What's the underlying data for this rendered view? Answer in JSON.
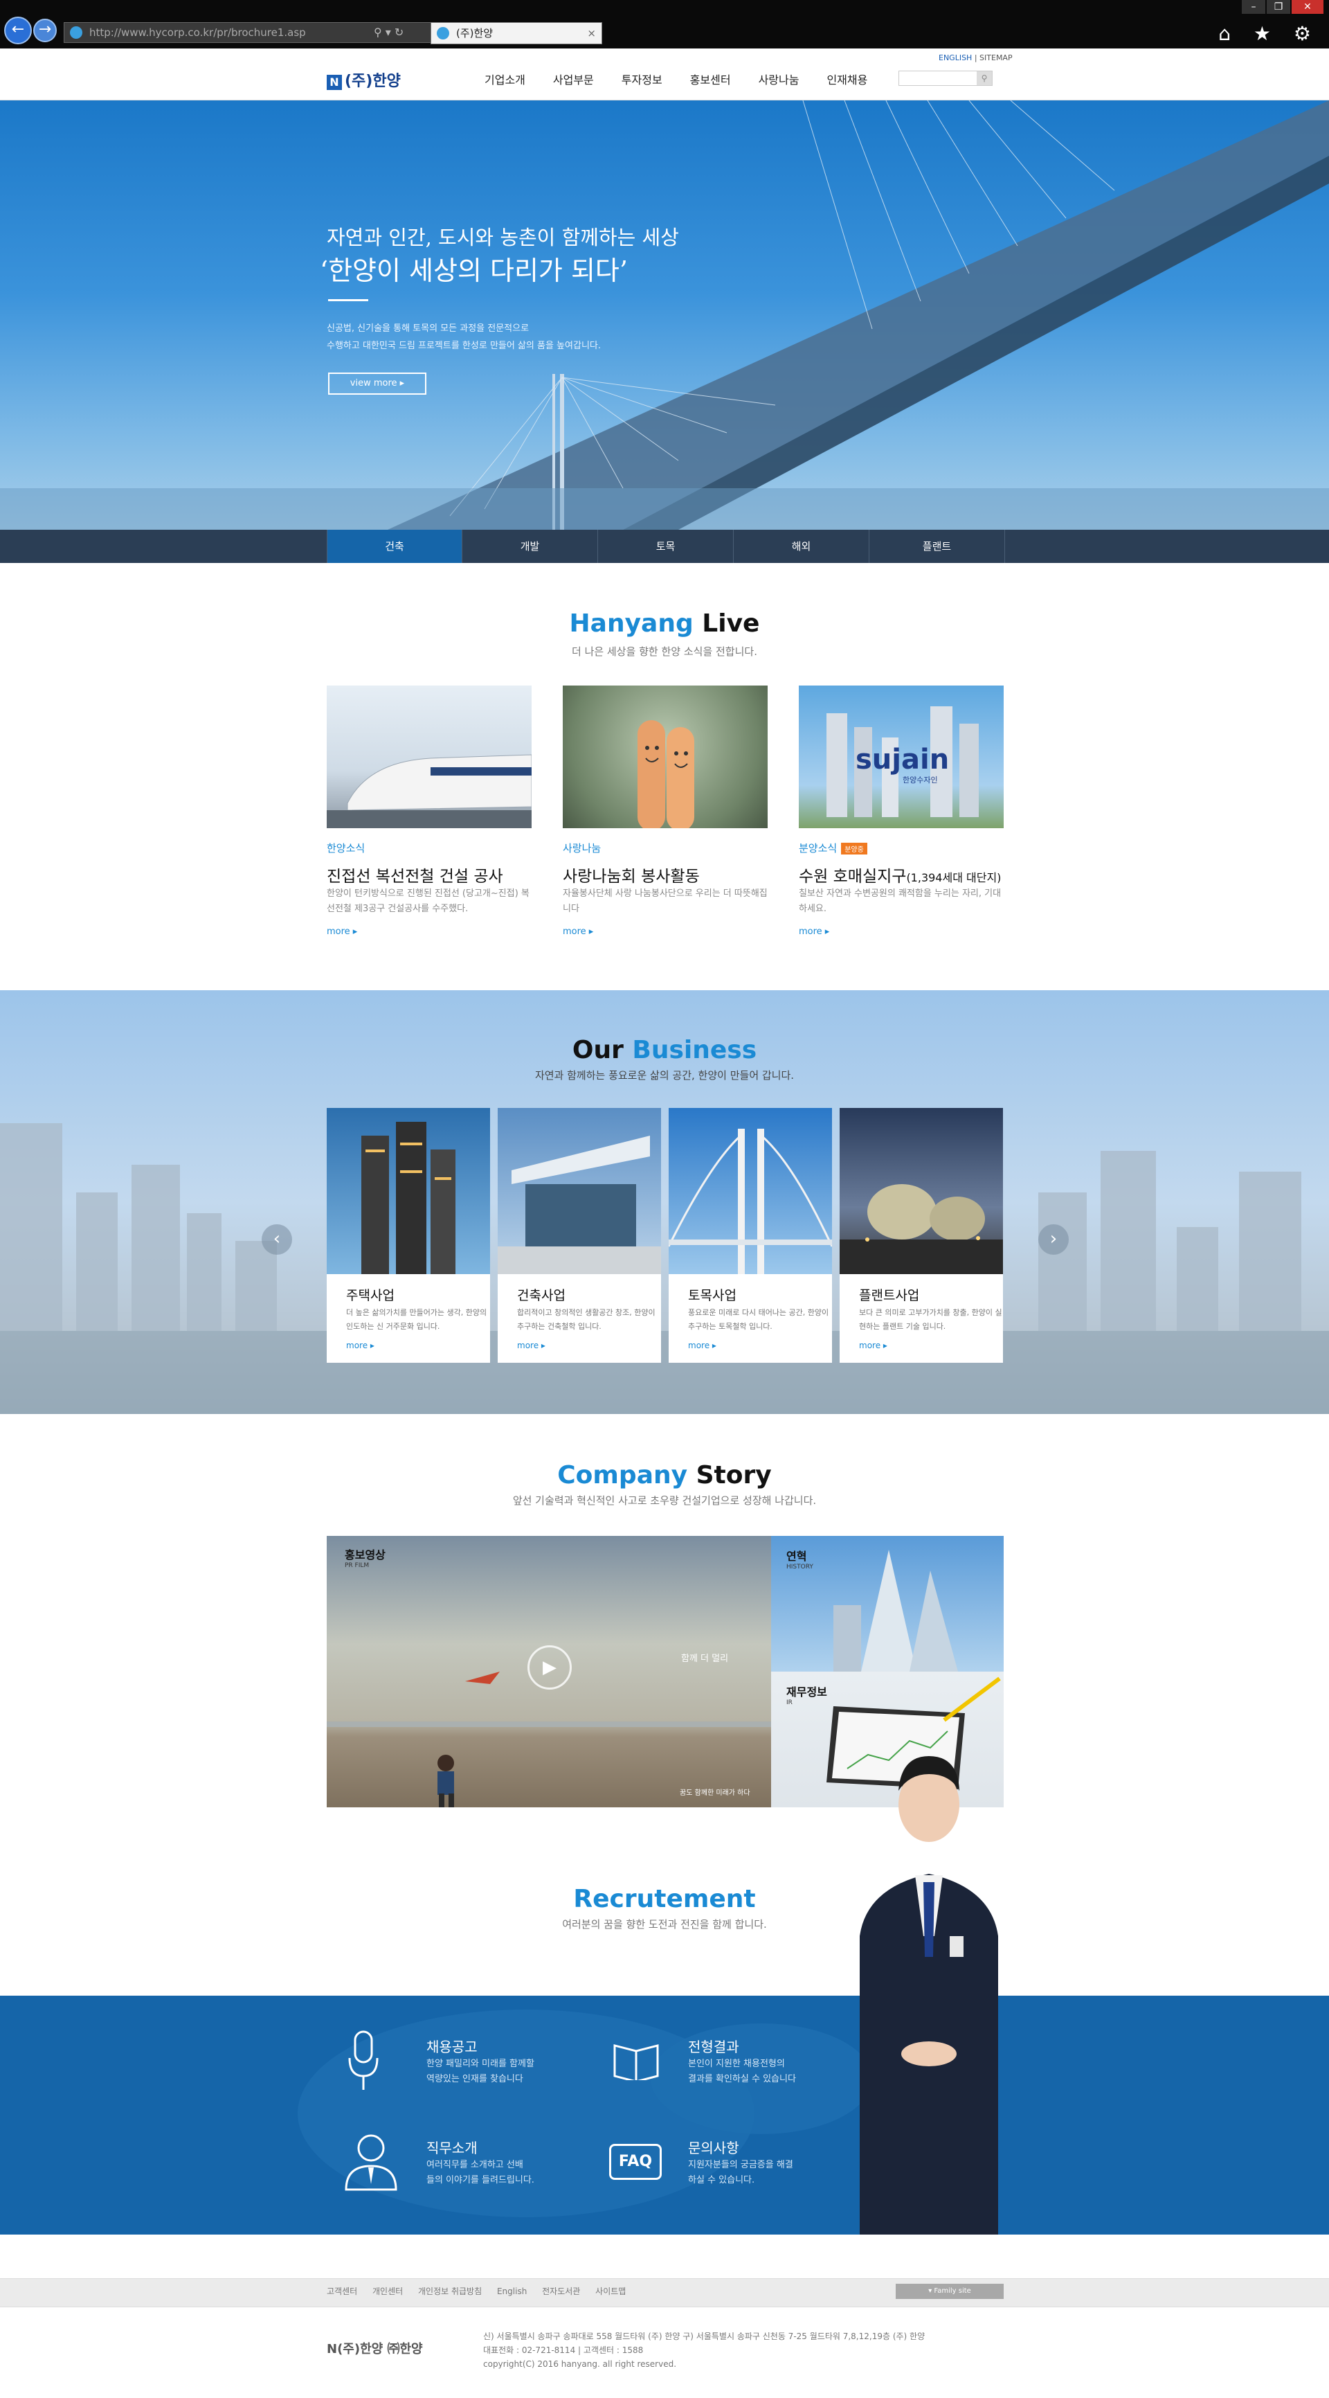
{
  "browser": {
    "url": "http://www.hycorp.co.kr/pr/brochure1.asp",
    "tab_title": "(주)한양",
    "back_glyph": "←",
    "forward_glyph": "→",
    "tab_close_glyph": "×",
    "window_controls": [
      "–",
      "❐",
      "✕"
    ],
    "tools_glyphs": "⌂ ★ ⚙",
    "address_tools": "⚲ ▾ ↻"
  },
  "header": {
    "logo_mark": "N",
    "logo_text": "(주)한양",
    "util_links": {
      "english": "ENGLISH",
      "sep": " | ",
      "sitemap": "SITEMAP"
    },
    "nav": [
      "기업소개",
      "사업부문",
      "투자정보",
      "홍보센터",
      "사랑나눔",
      "인재채용"
    ],
    "search_button_glyph": "⚲"
  },
  "hero": {
    "line1": "자연과 인간, 도시와 농촌이 함께하는 세상",
    "line2": "‘한양이 세상의 다리가 되다’",
    "desc1": "신공법, 신기술을 통해 토목의 모든 과정을 전문적으로",
    "desc2": "수행하고 대한민국 드림 프로젝트를 한성로 만들어 삶의 품을 높여갑니다.",
    "button": "view more ▸",
    "tabs": [
      "건축",
      "개발",
      "토목",
      "해외",
      "플랜트"
    ],
    "active_tab": 0
  },
  "live": {
    "title_a": "Hanyang",
    "title_b": " Live",
    "subtitle": "더 나은 세상을 향한 한양 소식을 전합니다.",
    "items": [
      {
        "category": "한양소식",
        "badge": "",
        "title": "진접선 복선전철 건설 공사",
        "desc": "한양이 턴키방식으로 진행된 진접선 (당고개~진접) 복선전철 제3공구 건설공사를 수주했다.",
        "more": "more ▸"
      },
      {
        "category": "사랑나눔",
        "badge": "",
        "title": "사랑나눔회 봉사활동",
        "desc": "자율봉사단체 사랑 나눔봉사단으로 우리는 더 따뜻해집니다",
        "more": "more ▸"
      },
      {
        "category": "분양소식",
        "badge": "분양중",
        "title": "수원 호매실지구",
        "title_small": "(1,394세대 대단지)",
        "desc": "칠보산 자연과 수변공원의 쾌적함을 누리는 자리, 기대하세요.",
        "more": "more ▸"
      }
    ],
    "logo_text": "sujain",
    "logo_sub": "한양수자인"
  },
  "business": {
    "title_a": "Our",
    "title_b": " Business",
    "subtitle": "자연과 함께하는 풍요로운 삶의 공간, 한양이 만들어 갑니다.",
    "items": [
      {
        "title": "주택사업",
        "desc": "더 높은 삶의가치를 만들어가는 생각, 한양의 인도하는 신 거주문화 입니다.",
        "more": "more ▸"
      },
      {
        "title": "건축사업",
        "desc": "합리적이고 창의적인 생활공간 창조, 한양이 추구하는 건축철학 입니다.",
        "more": "more ▸"
      },
      {
        "title": "토목사업",
        "desc": "풍요로운 미래로 다시 태어나는 공간, 한양이 추구하는 토목철학 입니다.",
        "more": "more ▸"
      },
      {
        "title": "플랜트사업",
        "desc": "보다 큰 의미로 고부가가치를 창출, 한양이 실현하는 플랜트 기술 입니다.",
        "more": "more ▸"
      }
    ],
    "prev_glyph": "‹",
    "next_glyph": "›"
  },
  "story": {
    "title_a": "Company",
    "title_b": " Story",
    "subtitle": "앞선 기술력과 혁신적인 사고로 초우량 건설기업으로 성장해 나갑니다.",
    "pr_film": {
      "label": "홍보영상",
      "en": "PR FILM",
      "overlay": "함께 더 멀리",
      "caption": "꿈도 함께한 미래가 하다",
      "play_glyph": "▶"
    },
    "history": {
      "label": "연혁",
      "en": "HISTORY"
    },
    "ir": {
      "label": "재무정보",
      "en": "IR"
    }
  },
  "recruit": {
    "title": "Recrutement",
    "subtitle": "여러분의 꿈을 향한 도전과 전진을 함께 합니다.",
    "items": [
      {
        "title": "채용공고",
        "desc1": "한양 패밀리와 미래를 함께할",
        "desc2": "역량있는 인재를 찾습니다"
      },
      {
        "title": "전형결과",
        "desc1": "본인이 지원한 채용전형의",
        "desc2": "결과를 확인하실 수 있습니다"
      },
      {
        "title": "직무소개",
        "desc1": "여러직무를 소개하고 선배",
        "desc2": "들의 이야기를 들려드립니다."
      },
      {
        "title": "문의사항",
        "desc1": "지원자분들의 궁금증을 해결",
        "desc2": "하실 수 있습니다."
      }
    ],
    "faq_icon_text": "FAQ"
  },
  "footer": {
    "links": [
      "고객센터",
      "개인센터",
      "개인정보 취급방침",
      "English",
      "전자도서관",
      "사이트맵"
    ],
    "family_site": "▾ Family site",
    "logo": "N(주)한양 ㈜한양",
    "address": "신) 서울특별시 송파구 송파대로 558 월드타워 (주) 한양 구) 서울특별시 송파구 신천동 7-25 월드타워 7,8,12,19층 (주) 한양",
    "phone": "대표전화 : 02-721-8114  |  고객센터 : 1588",
    "copyright": "copyright(C) 2016 hanyang. all right reserved."
  },
  "colors": {
    "accent": "#1a8ad4",
    "brand_navy": "#123f8c",
    "recruit_band": "#1565a9",
    "hero_tab_bar": "#2b3e55"
  }
}
